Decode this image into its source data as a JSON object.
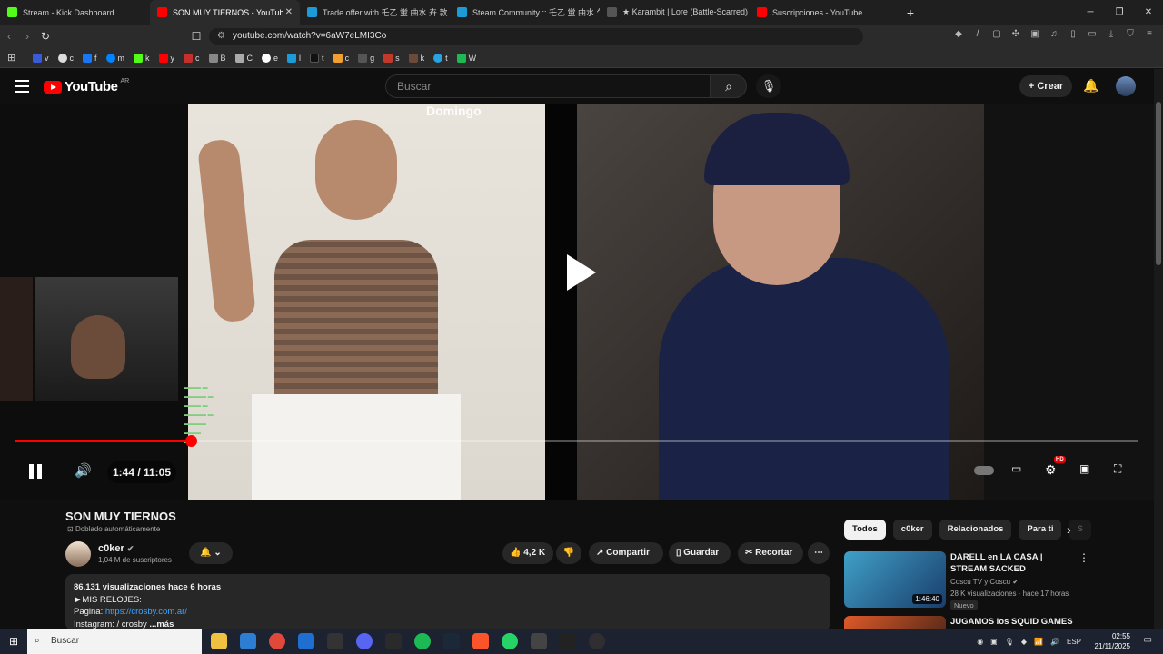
{
  "browser": {
    "tabs": [
      {
        "label": "Stream - Kick Dashboard",
        "color": "#53fc18"
      },
      {
        "label": "SON MUY TIERNOS - YouTub",
        "color": "#ff0000"
      },
      {
        "label": "Trade offer with 乇乙 蛍 曲水 卉 敦",
        "color": "#1b9bd7"
      },
      {
        "label": "Steam Community :: 乇乙 蛍 曲水 乍",
        "color": "#1b9bd7"
      },
      {
        "label": "★ Karambit | Lore (Battle-Scarred) _",
        "color": "#888888"
      },
      {
        "label": "Suscripciones - YouTube",
        "color": "#ff0000"
      }
    ],
    "new_tab": "+",
    "url": "youtube.com/watch?v=6aW7eLMI3Co",
    "bookmarks": [
      {
        "label": "v",
        "color": "#3a5bd9"
      },
      {
        "label": "c",
        "color": "#ddd"
      },
      {
        "label": "f",
        "color": "#1877f2"
      },
      {
        "label": "m",
        "color": "#0084ff"
      },
      {
        "label": "k",
        "color": "#53fc18"
      },
      {
        "label": "y",
        "color": "#ff0000"
      },
      {
        "label": "c",
        "color": "#c4302b"
      },
      {
        "label": "B",
        "color": "#888"
      },
      {
        "label": "C",
        "color": "#aaa"
      },
      {
        "label": "e",
        "color": "#fff"
      },
      {
        "label": "l",
        "color": "#1b9bd7"
      },
      {
        "label": "t",
        "color": "#000"
      },
      {
        "label": "c",
        "color": "#f0a030"
      },
      {
        "label": "g",
        "color": "#555"
      },
      {
        "label": "s",
        "color": "#c0392b"
      },
      {
        "label": "k",
        "color": "#6b4a3a"
      },
      {
        "label": "t",
        "color": "#2aa1e0"
      },
      {
        "label": "W",
        "color": "#1db954"
      }
    ]
  },
  "youtube": {
    "logo": "YouTube",
    "country": "AR",
    "search_placeholder": "Buscar",
    "create_label": "Crear"
  },
  "player": {
    "overlay_text": "Domingo",
    "time": "1:44 / 11:05",
    "progress": 0.157,
    "hd_badge": "HD"
  },
  "video": {
    "title": "SON MUY TIERNOS",
    "dubbing": "Doblado automáticamente",
    "channel": "c0ker",
    "subscribers": "1,04 M de suscriptores",
    "likes": "4,2 K",
    "share": "Compartir",
    "save": "Guardar",
    "clip": "Recortar",
    "description": {
      "stats": "86.131 visualizaciones  hace 6 horas",
      "line1": "►MIS RELOJES:",
      "line2_label": "Pagina: ",
      "line2_link": "https://crosby.com.ar/",
      "line3": "Instagram:  / crosby",
      "more": "...más"
    }
  },
  "sidebar": {
    "chips": [
      "Todos",
      "c0ker",
      "Relacionados",
      "Para ti",
      "S"
    ],
    "recs": [
      {
        "title": "DARELL en LA CASA | STREAM SACKED",
        "channel": "Coscu TV y Coscu",
        "meta": "28 K visualizaciones · hace 17 horas",
        "badge": "Nuevo",
        "duration": "1:46:40"
      },
      {
        "title": "JUGAMOS los SQUID GAMES -",
        "channel": "",
        "meta": "",
        "badge": "",
        "duration": ""
      }
    ]
  },
  "taskbar": {
    "search": "Buscar",
    "lang": "ESP",
    "time": "02:55",
    "date": "21/11/2025"
  }
}
